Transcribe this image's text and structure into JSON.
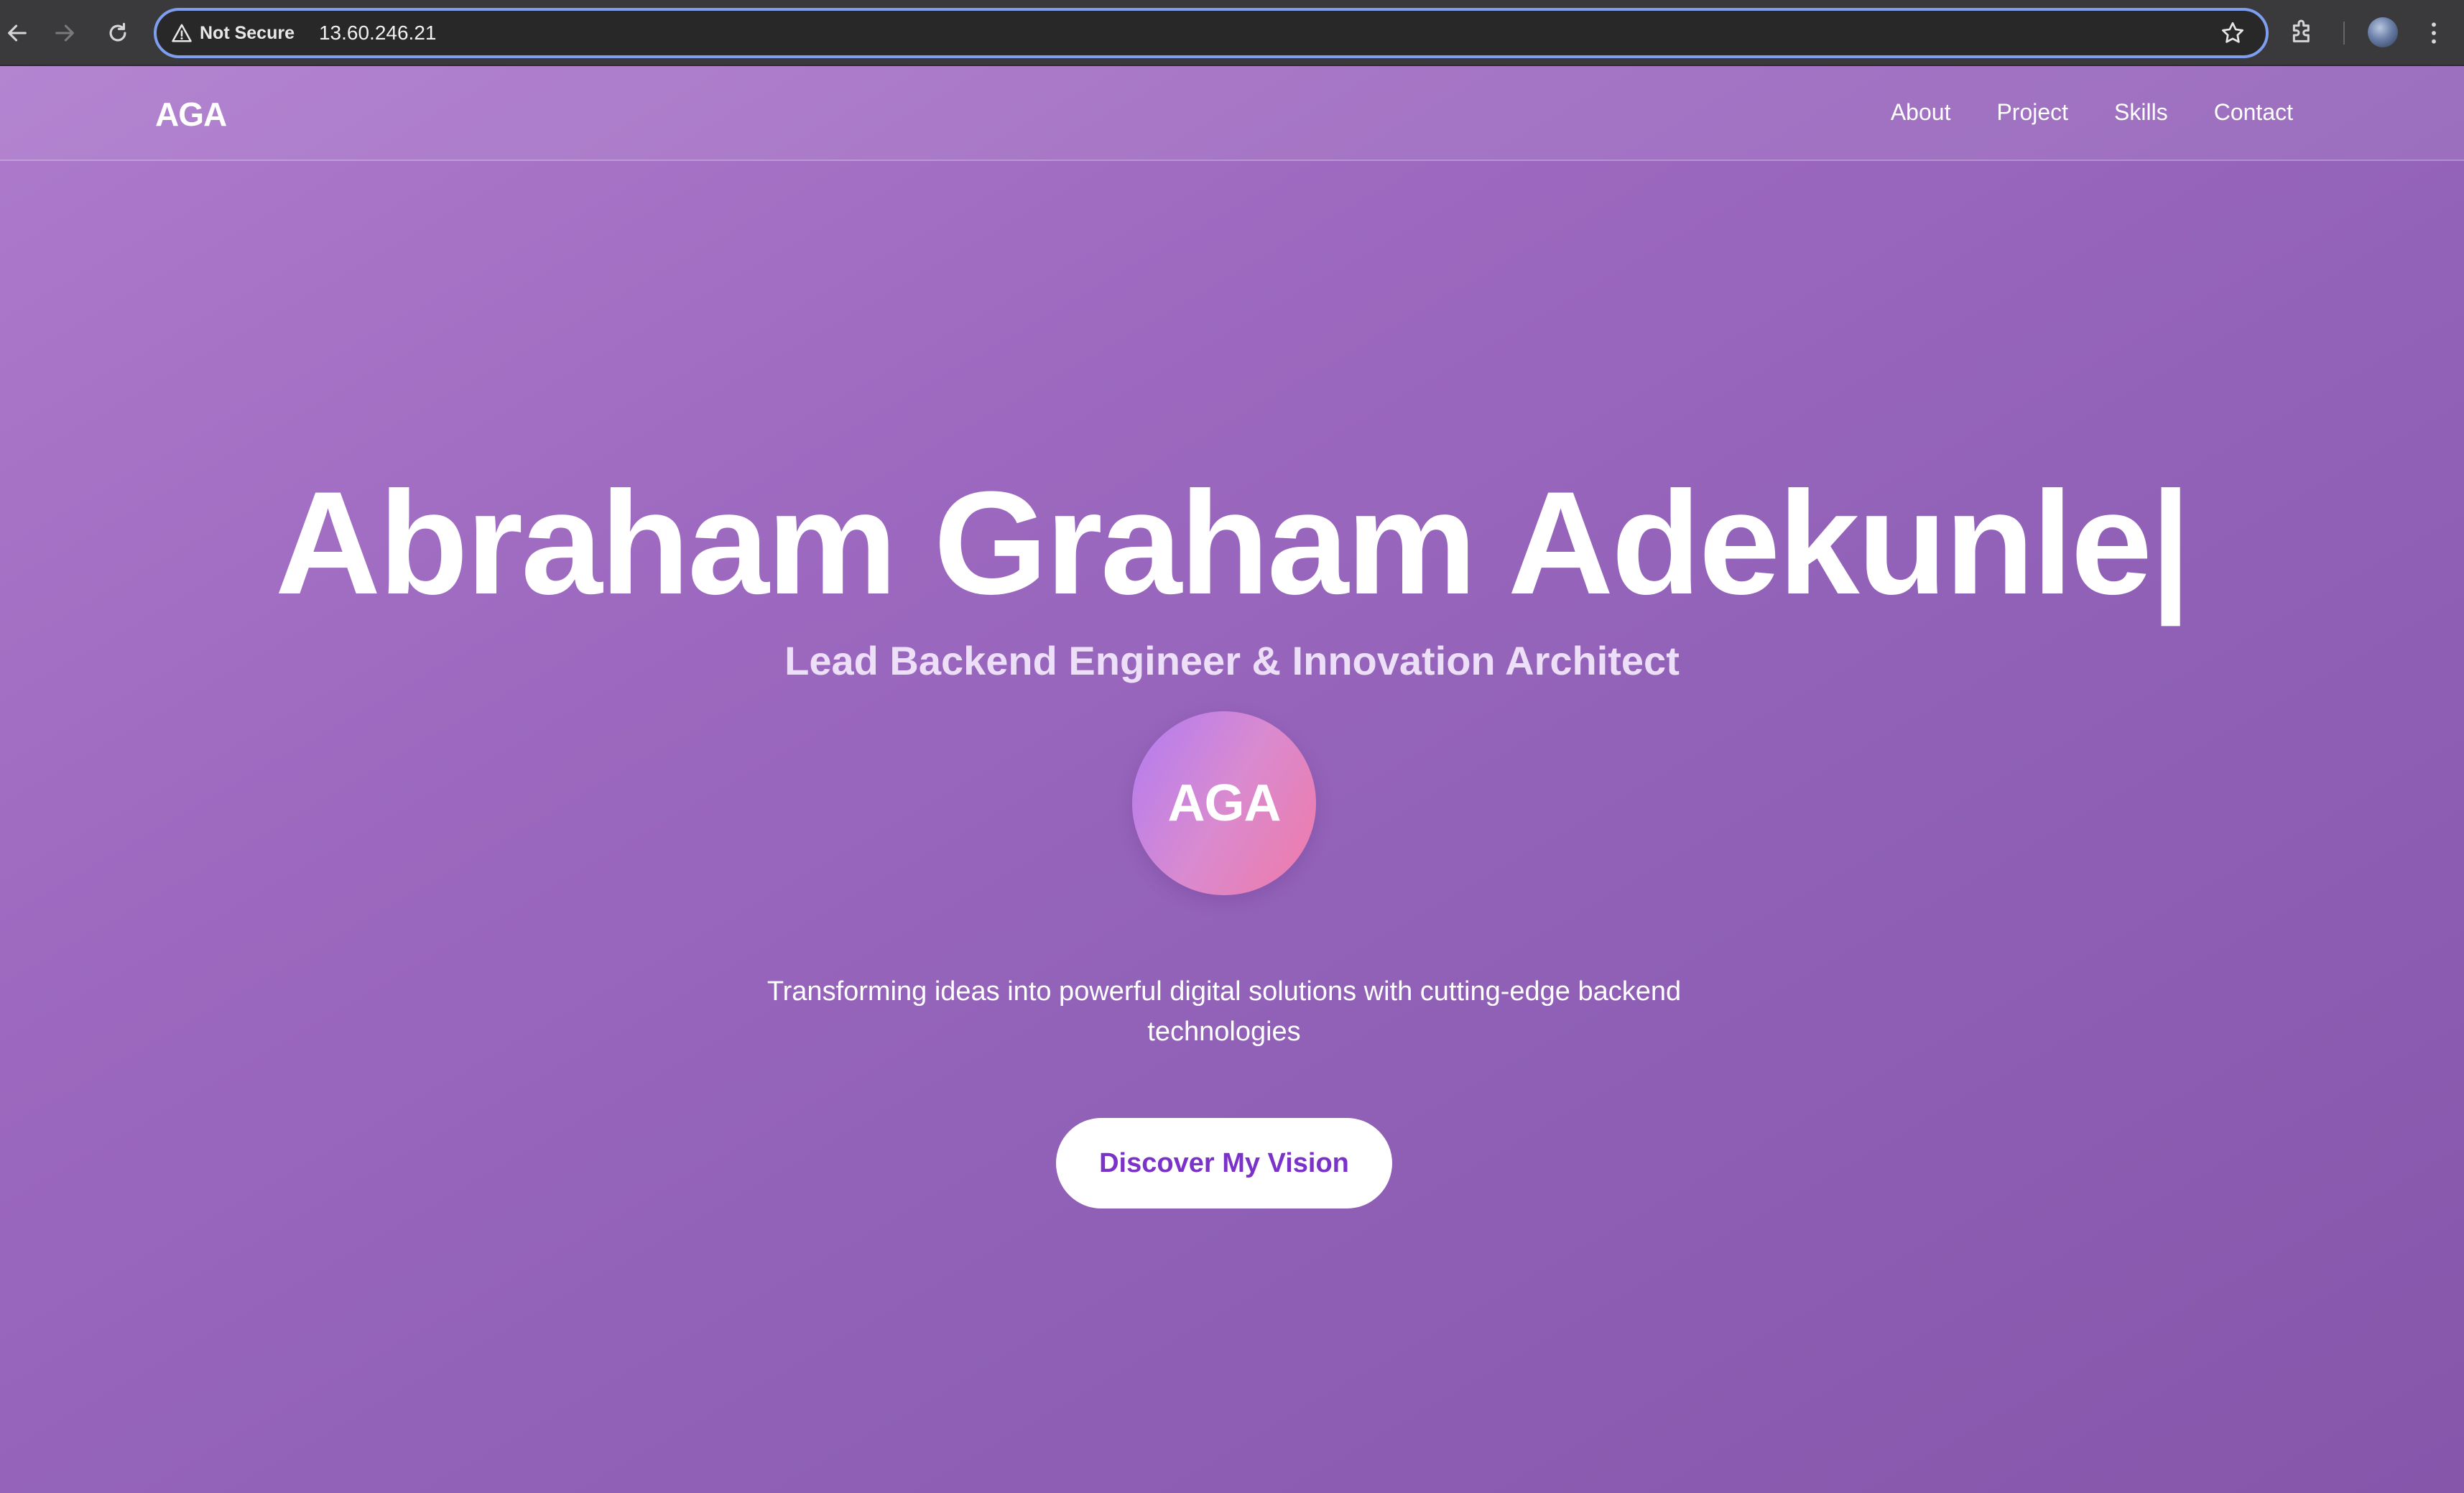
{
  "browser": {
    "security_label": "Not Secure",
    "url": "13.60.246.21"
  },
  "header": {
    "brand": "AGA",
    "nav": [
      {
        "label": "About"
      },
      {
        "label": "Project"
      },
      {
        "label": "Skills"
      },
      {
        "label": "Contact"
      }
    ]
  },
  "hero": {
    "name": "Abraham Graham Adekunle|",
    "subtitle": "Lead Backend Engineer & Innovation Architect",
    "logo_initials": "AGA",
    "description": "Transforming ideas into powerful digital solutions with cutting-edge backend technologies",
    "cta_label": "Discover My Vision"
  },
  "colors": {
    "accent": "#7b32c8",
    "background_start": "#ad7acc",
    "background_end": "#8656ab",
    "logo_gradient_start": "#b17cf2",
    "logo_gradient_end": "#f07aa8",
    "omnibox_border": "#7f9ef0"
  },
  "icons": [
    "back-arrow-icon",
    "forward-arrow-icon",
    "reload-icon",
    "warning-triangle-icon",
    "bookmark-star-icon",
    "extensions-puzzle-icon",
    "kebab-menu-icon"
  ]
}
